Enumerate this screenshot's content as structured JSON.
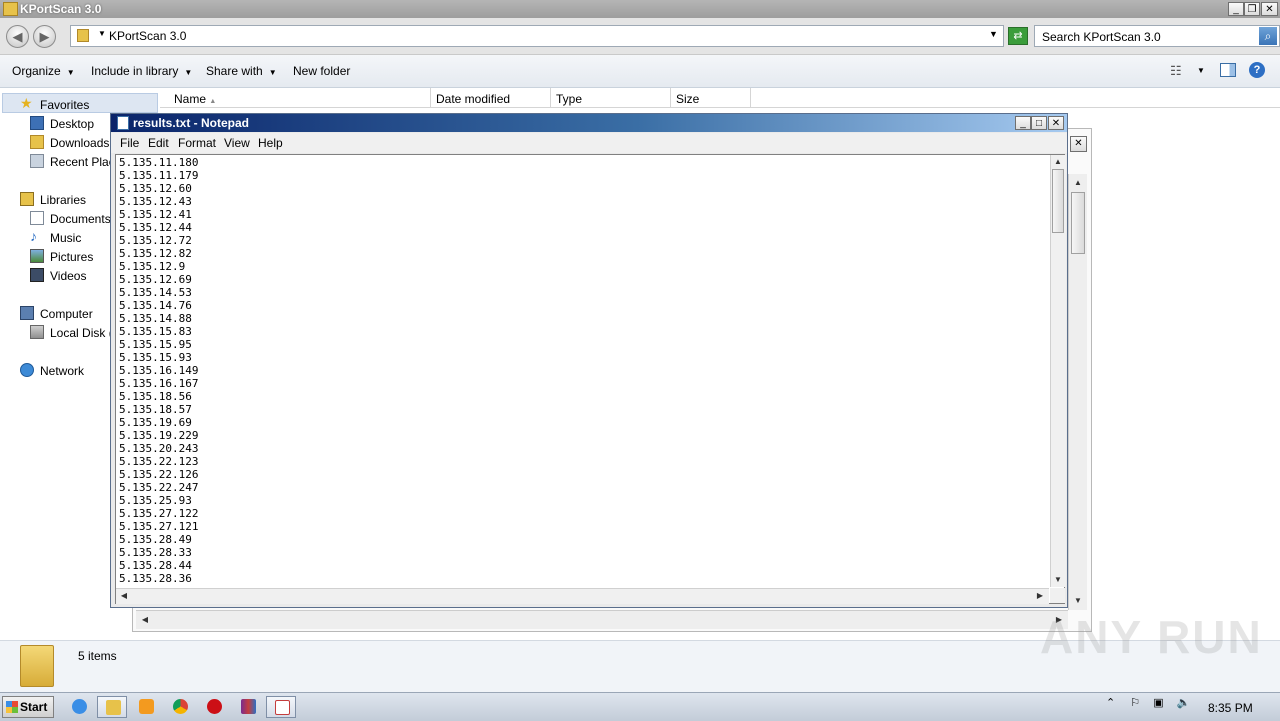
{
  "explorer": {
    "title": "KPortScan 3.0",
    "address_path": "KPortScan 3.0",
    "search_placeholder": "Search KPortScan 3.0",
    "toolbar": {
      "organize": "Organize",
      "include_in_library": "Include in library",
      "share_with": "Share with",
      "new_folder": "New folder"
    },
    "nav": {
      "favorites": "Favorites",
      "desktop": "Desktop",
      "downloads": "Downloads",
      "recent_places": "Recent Place",
      "libraries": "Libraries",
      "documents": "Documents",
      "music": "Music",
      "pictures": "Pictures",
      "videos": "Videos",
      "computer": "Computer",
      "local_disk": "Local Disk (C",
      "network": "Network"
    },
    "columns": [
      "Name",
      "Date modified",
      "Type",
      "Size"
    ],
    "status_count": "5 items"
  },
  "notepad": {
    "title": "results.txt - Notepad",
    "menu": [
      "File",
      "Edit",
      "Format",
      "View",
      "Help"
    ],
    "lines": [
      "5.135.11.180",
      "5.135.11.179",
      "5.135.12.60",
      "5.135.12.43",
      "5.135.12.41",
      "5.135.12.44",
      "5.135.12.72",
      "5.135.12.82",
      "5.135.12.9",
      "5.135.12.69",
      "5.135.14.53",
      "5.135.14.76",
      "5.135.14.88",
      "5.135.15.83",
      "5.135.15.95",
      "5.135.15.93",
      "5.135.16.149",
      "5.135.16.167",
      "5.135.18.56",
      "5.135.18.57",
      "5.135.19.69",
      "5.135.19.229",
      "5.135.20.243",
      "5.135.22.123",
      "5.135.22.126",
      "5.135.22.247",
      "5.135.25.93",
      "5.135.27.122",
      "5.135.27.121",
      "5.135.28.49",
      "5.135.28.33",
      "5.135.28.44",
      "5.135.28.36"
    ]
  },
  "taskbar": {
    "start_label": "Start",
    "clock": "8:35 PM"
  },
  "watermark": "ANY RUN"
}
